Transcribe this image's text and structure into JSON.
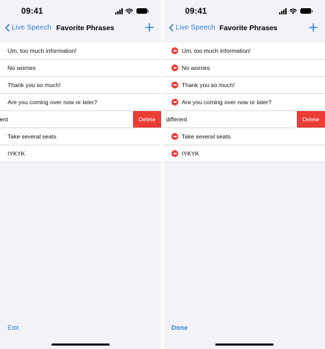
{
  "left_screen": {
    "status_time": "09:41",
    "nav": {
      "back_label": "Live Speech",
      "title": "Favorite Phrases"
    },
    "phrases": [
      "Um, too much information!",
      "No worries",
      "Thank you so much!",
      "Are you coming over now or later?",
      "erent",
      "Take several seats",
      "IYKYK"
    ],
    "delete_label": "Delete",
    "bottom_button": "Edit"
  },
  "right_screen": {
    "status_time": "09:41",
    "nav": {
      "back_label": "Live Speech",
      "title": "Favorite Phrases"
    },
    "phrases": [
      "Um, too much information!",
      "No worries",
      "Thank you so much!",
      "Are you coming over now or later?",
      "different",
      "Take several seats",
      "IYKYK"
    ],
    "delete_label": "Delete",
    "bottom_button": "Done"
  },
  "colors": {
    "accent": "#2f7fd6",
    "destructive": "#ea3d35",
    "background": "#f2f2f7"
  },
  "icons": {
    "back": "chevron-left-icon",
    "add": "plus-icon",
    "remove": "minus-circle-icon"
  }
}
